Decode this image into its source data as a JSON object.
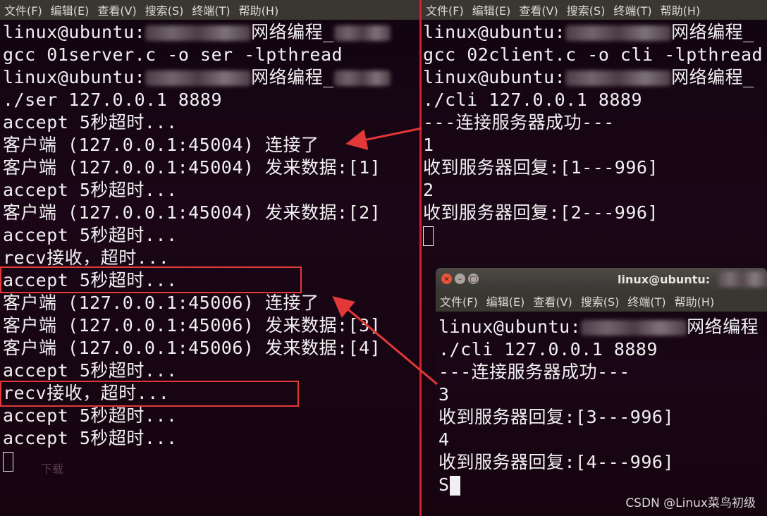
{
  "menu": {
    "items": [
      "文件(F)",
      "编辑(E)",
      "查看(V)",
      "搜索(S)",
      "终端(T)",
      "帮助(H)"
    ]
  },
  "left_terminal": {
    "lines": [
      "linux@ubuntu:",
      "gcc 01server.c -o ser -lpthread",
      "linux@ubuntu:",
      "./ser 127.0.0.1 8889",
      "accept 5秒超时...",
      "客户端 (127.0.0.1:45004) 连接了",
      "客户端 (127.0.0.1:45004) 发来数据:[1]",
      "accept 5秒超时...",
      "客户端 (127.0.0.1:45004) 发来数据:[2]",
      "accept 5秒超时...",
      "recv接收，超时...",
      "accept 5秒超时...",
      "客户端 (127.0.0.1:45006) 连接了",
      "客户端 (127.0.0.1:45006) 发来数据:[3]",
      "客户端 (127.0.0.1:45006) 发来数据:[4]",
      "accept 5秒超时...",
      "recv接收，超时...",
      "accept 5秒超时...",
      "accept 5秒超时..."
    ],
    "prompt_suffix": "网络编程_",
    "ghost_text": "下载"
  },
  "right_terminal": {
    "lines": [
      "linux@ubuntu:",
      "gcc 02client.c -o cli -lpthread",
      "linux@ubuntu:",
      "./cli 127.0.0.1 8889",
      "---连接服务器成功---",
      "1",
      "收到服务器回复:[1---996]",
      "2",
      "收到服务器回复:[2---996]"
    ],
    "prompt_suffix": "网络编程_"
  },
  "float_terminal": {
    "title": "linux@ubuntu:",
    "lines": [
      "linux@ubuntu:",
      "./cli 127.0.0.1 8889",
      "---连接服务器成功---",
      "3",
      "收到服务器回复:[3---996]",
      "4",
      "收到服务器回复:[4---996]",
      "S"
    ],
    "prompt_suffix": "网络编程"
  },
  "watermark": "CSDN @Linux菜鸟初级",
  "colors": {
    "terminal_bg": "#16040f",
    "menubar_bg": "#3a3733",
    "annotation_red": "#e23838",
    "close_button": "#e8553a"
  }
}
